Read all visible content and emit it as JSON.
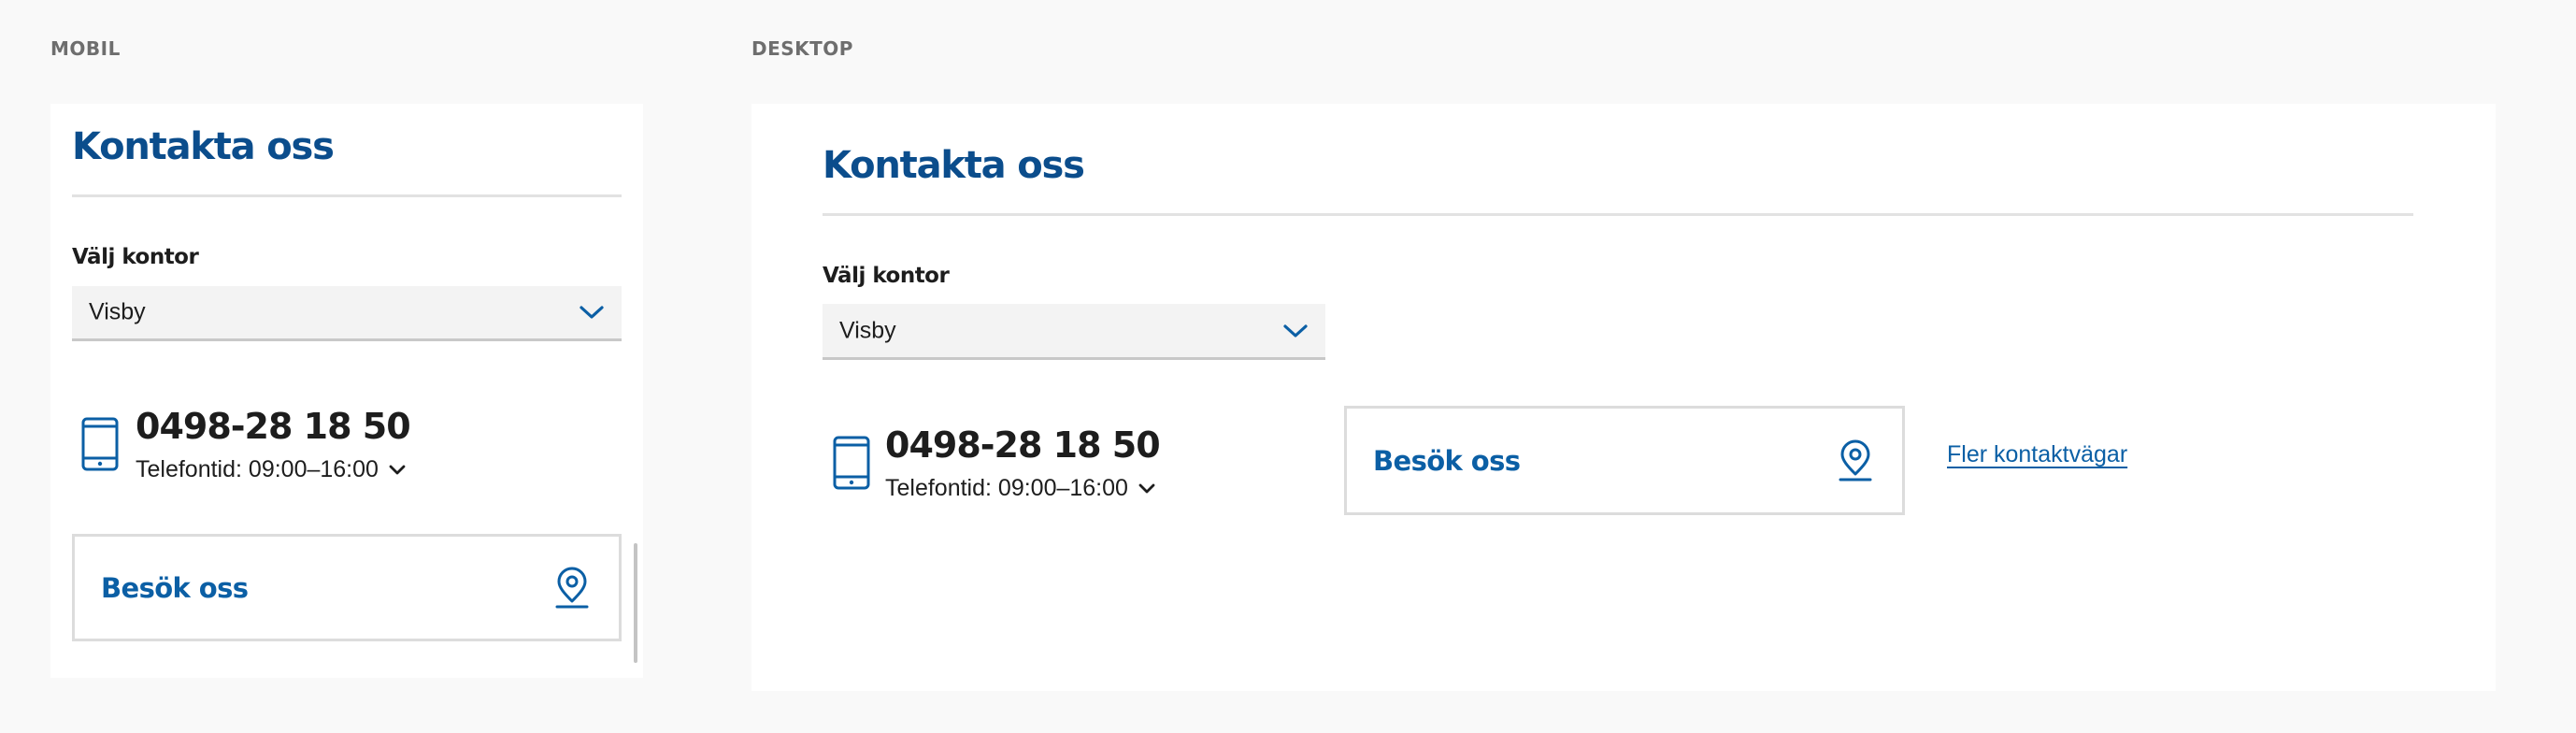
{
  "mobile": {
    "section_label": "MOBIL",
    "title": "Kontakta oss",
    "office_label": "Välj kontor",
    "office_value": "Visby",
    "phone_number": "0498-28 18 50",
    "phone_hours": "Telefontid: 09:00–16:00",
    "visit_label": "Besök oss"
  },
  "desktop": {
    "section_label": "DESKTOP",
    "title": "Kontakta oss",
    "office_label": "Välj kontor",
    "office_value": "Visby",
    "phone_number": "0498-28 18 50",
    "phone_hours": "Telefontid: 09:00–16:00",
    "visit_label": "Besök oss",
    "more_link": "Fler kontaktvägar"
  },
  "icons": {
    "phone": "mobile-phone-icon",
    "select": "chevron-down-icon",
    "hours": "chevron-down-icon",
    "visit": "map-pin-icon"
  },
  "colors": {
    "background": "#f9f9f9",
    "card": "#ffffff",
    "brand_blue": "#0b4d8c",
    "link_blue": "#0b5fa5",
    "text": "#1d1d1d",
    "muted_label": "#6e6e6e"
  }
}
